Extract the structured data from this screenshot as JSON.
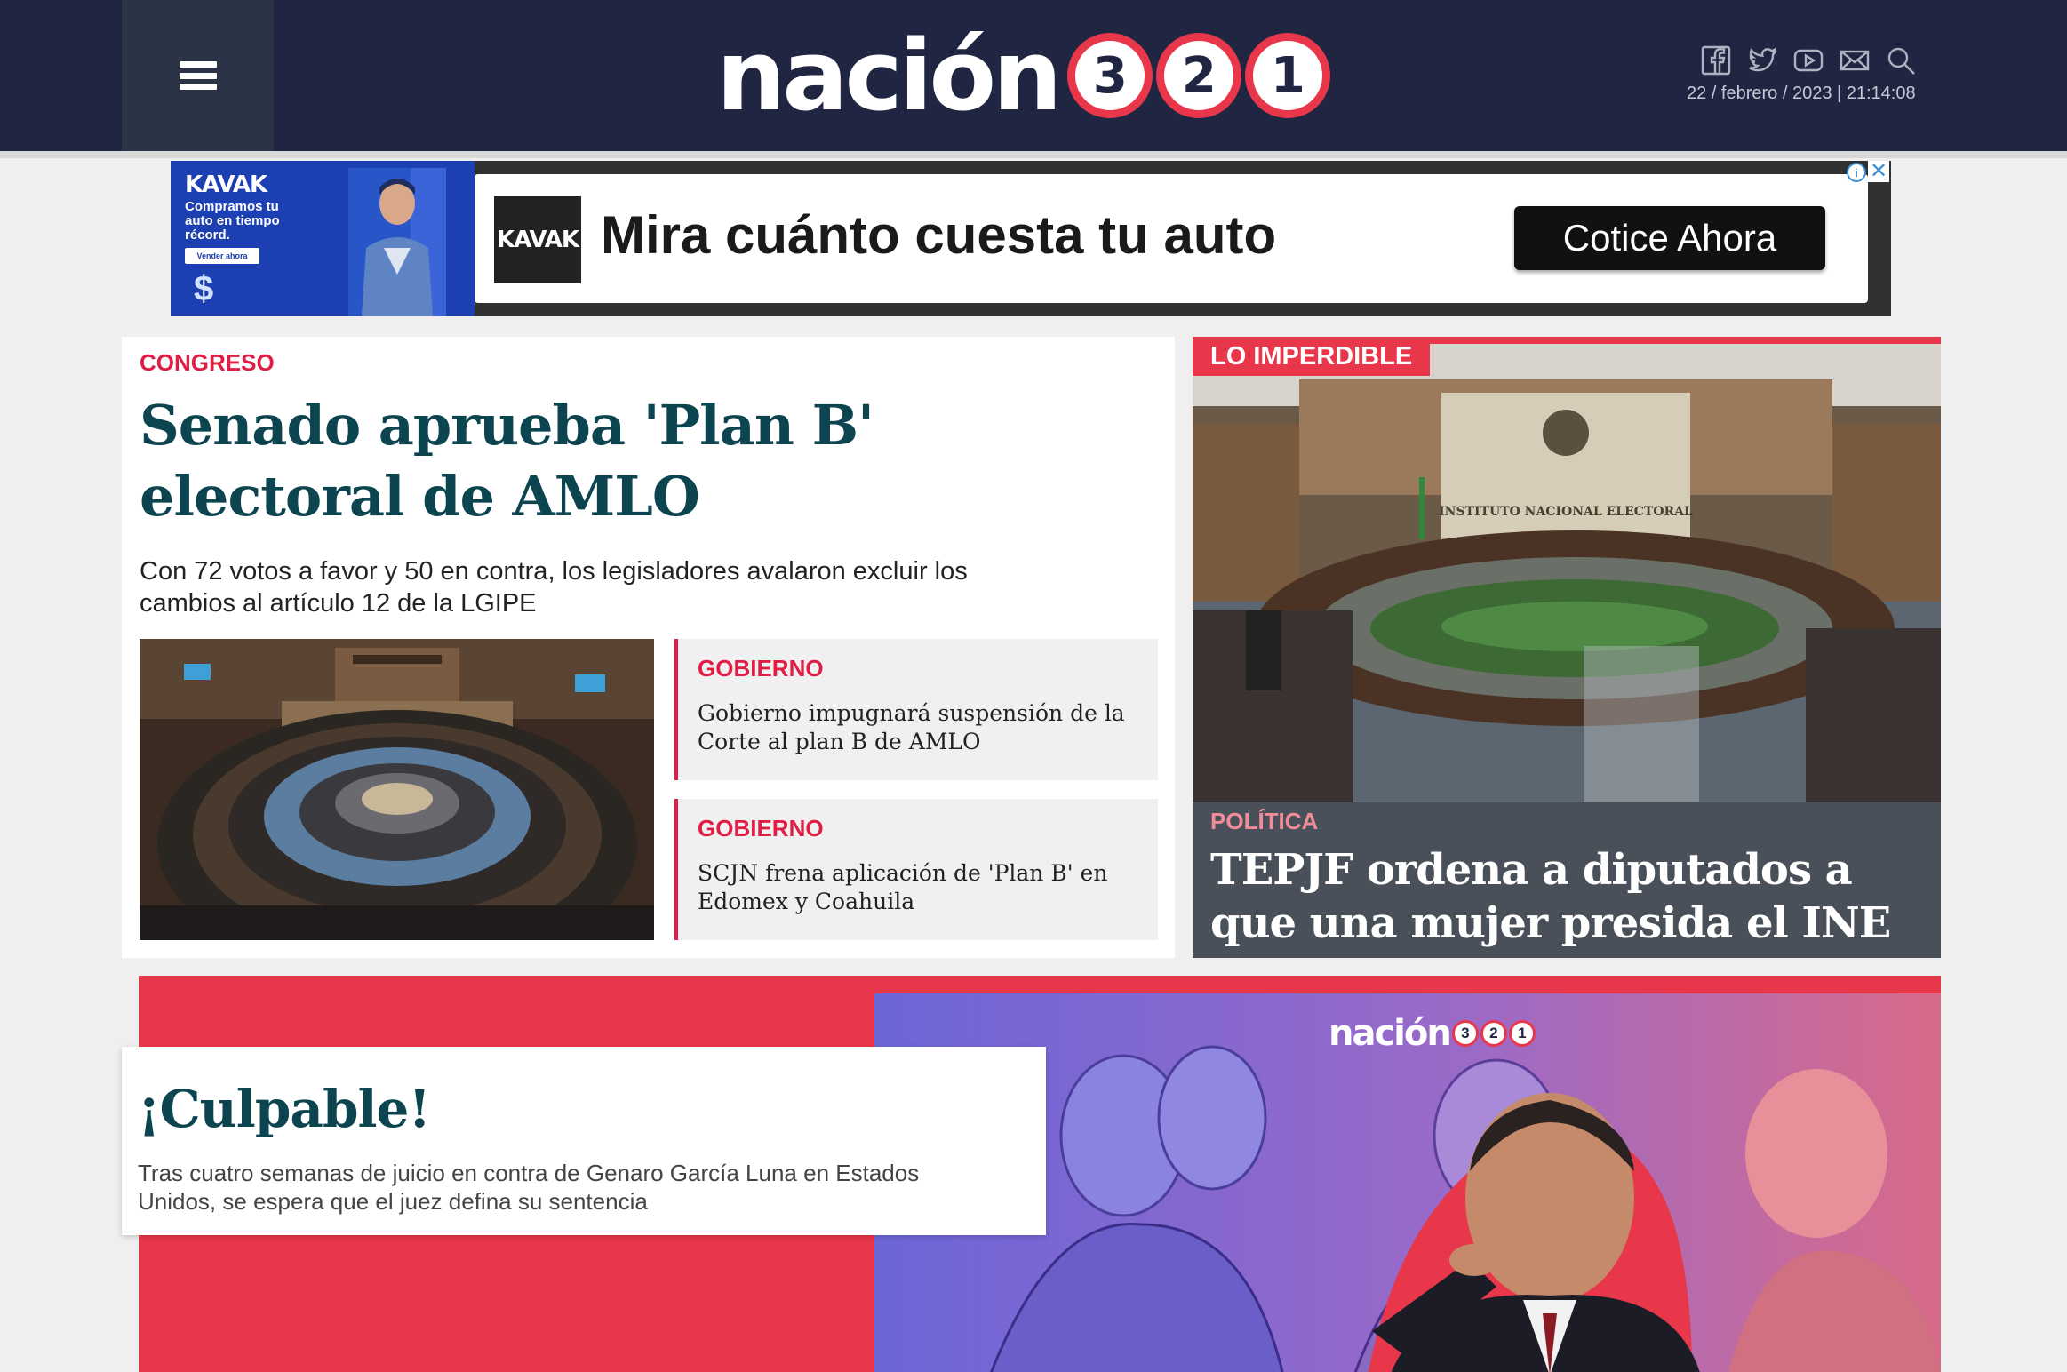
{
  "header": {
    "logo_word": "nación",
    "logo_digits": [
      "3",
      "2",
      "1"
    ],
    "date": "22 / febrero / 2023 | 21:14:08",
    "social_icons": [
      "facebook-icon",
      "twitter-icon",
      "youtube-icon",
      "mail-icon",
      "search-icon"
    ]
  },
  "ad": {
    "brand": "KAVAK",
    "tagline": "Compramos tu auto en tiempo récord.",
    "sell_label": "Vender ahora",
    "headline": "Mira cuánto cuesta tu auto",
    "cta": "Cotice Ahora",
    "info": "i",
    "close": "✕"
  },
  "main": {
    "category": "CONGRESO",
    "title": "Senado aprueba 'Plan B' electoral de AMLO",
    "subtitle": "Con 72 votos a favor y 50 en contra, los legisladores avalaron excluir los cambios al artículo 12 de la LGIPE",
    "side_items": [
      {
        "category": "GOBIERNO",
        "text": "Gobierno impugnará suspensión de la Corte al plan B de AMLO"
      },
      {
        "category": "GOBIERNO",
        "text": "SCJN frena aplicación de 'Plan B' en Edomex y Coahuila"
      }
    ]
  },
  "feature": {
    "badge": "LO IMPERDIBLE",
    "category": "POLÍTICA",
    "title": "TEPJF ordena a diputados a que una mujer presida el INE",
    "room_sign": "INSTITUTO NACIONAL ELECTORAL"
  },
  "banner": {
    "title": "¡Culpable!",
    "subtitle": "Tras cuatro semanas de juicio en contra de Genaro García Luna en Estados Unidos, se espera que el juez defina su sentencia",
    "logo_word": "nación",
    "logo_digits": [
      "3",
      "2",
      "1"
    ]
  },
  "colors": {
    "header_bg": "#202541",
    "accent": "#e8374a",
    "category_red": "#e01e45",
    "title_teal": "#0c4450"
  }
}
